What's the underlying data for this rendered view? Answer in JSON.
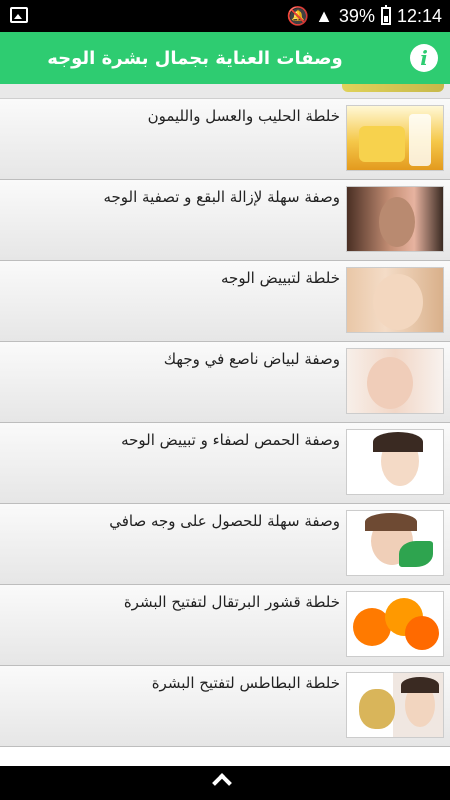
{
  "status": {
    "battery": "39%",
    "time": "12:14"
  },
  "header": {
    "title": "وصفات العناية بجمال بشرة الوجه"
  },
  "list": {
    "items": [
      {
        "label": "خلطة الحليب والعسل والليمون",
        "image_icon": "honey-milk-lemon"
      },
      {
        "label": "وصفة سهلة لإزالة البقع و تصفية الوجه",
        "image_icon": "face-spots"
      },
      {
        "label": "خلطة لتبييض الوجه",
        "image_icon": "woman-face"
      },
      {
        "label": "وصفة لبياض ناصع في وجهك",
        "image_icon": "woman-touching-face"
      },
      {
        "label": "وصفة الحمص لصفاء و تبييض الوحه",
        "image_icon": "woman-portrait"
      },
      {
        "label": "وصفة سهلة للحصول على وجه صافي",
        "image_icon": "woman-with-leaves"
      },
      {
        "label": "خلطة قشور البرتقال لتفتيح البشرة",
        "image_icon": "orange-peels"
      },
      {
        "label": "خلطة البطاطس لتفتيح البشرة",
        "image_icon": "potato-and-face"
      }
    ]
  },
  "colors": {
    "appbar": "#2ecc71",
    "statusbar": "#000000"
  }
}
